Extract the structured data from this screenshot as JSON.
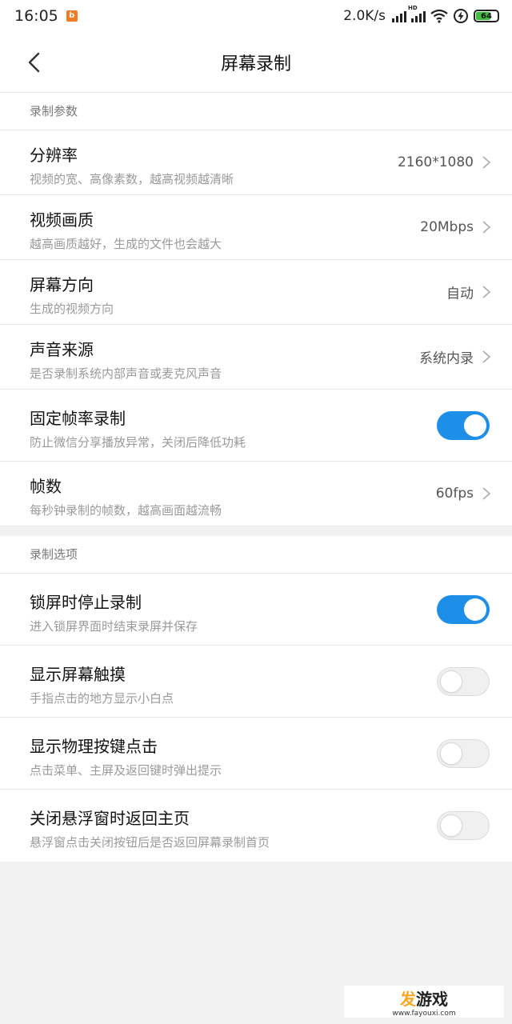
{
  "status": {
    "time": "16:05",
    "speed": "2.0K/s",
    "network_badge": "HD",
    "battery": "64"
  },
  "header": {
    "title": "屏幕录制"
  },
  "sections": [
    {
      "title": "录制参数",
      "rows": [
        {
          "label": "分辨率",
          "sub": "视频的宽、高像素数，越高视频越清晰",
          "value": "2160*1080"
        },
        {
          "label": "视频画质",
          "sub": "越高画质越好，生成的文件也会越大",
          "value": "20Mbps"
        },
        {
          "label": "屏幕方向",
          "sub": "生成的视频方向",
          "value": "自动"
        },
        {
          "label": "声音来源",
          "sub": "是否录制系统内部声音或麦克风声音",
          "value": "系统内录"
        },
        {
          "label": "固定帧率录制",
          "sub": "防止微信分享播放异常，关闭后降低功耗",
          "toggle": true
        },
        {
          "label": "帧数",
          "sub": "每秒钟录制的帧数，越高画面越流畅",
          "value": "60fps"
        }
      ]
    },
    {
      "title": "录制选项",
      "rows": [
        {
          "label": "锁屏时停止录制",
          "sub": "进入锁屏界面时结束录屏并保存",
          "toggle": true
        },
        {
          "label": "显示屏幕触摸",
          "sub": "手指点击的地方显示小白点",
          "toggle": false
        },
        {
          "label": "显示物理按键点击",
          "sub": "点击菜单、主屏及返回键时弹出提示",
          "toggle": false
        },
        {
          "label": "关闭悬浮窗时返回主页",
          "sub": "悬浮窗点击关闭按钮后是否返回屏幕录制首页",
          "toggle": false
        }
      ]
    }
  ],
  "watermark": {
    "logo_a": "发",
    "logo_b": "游戏",
    "url": "www.fayouxi.com"
  },
  "colors": {
    "accent": "#1e8fe8",
    "notification": "#f47a20",
    "battery_fill": "#3cbf3c"
  }
}
